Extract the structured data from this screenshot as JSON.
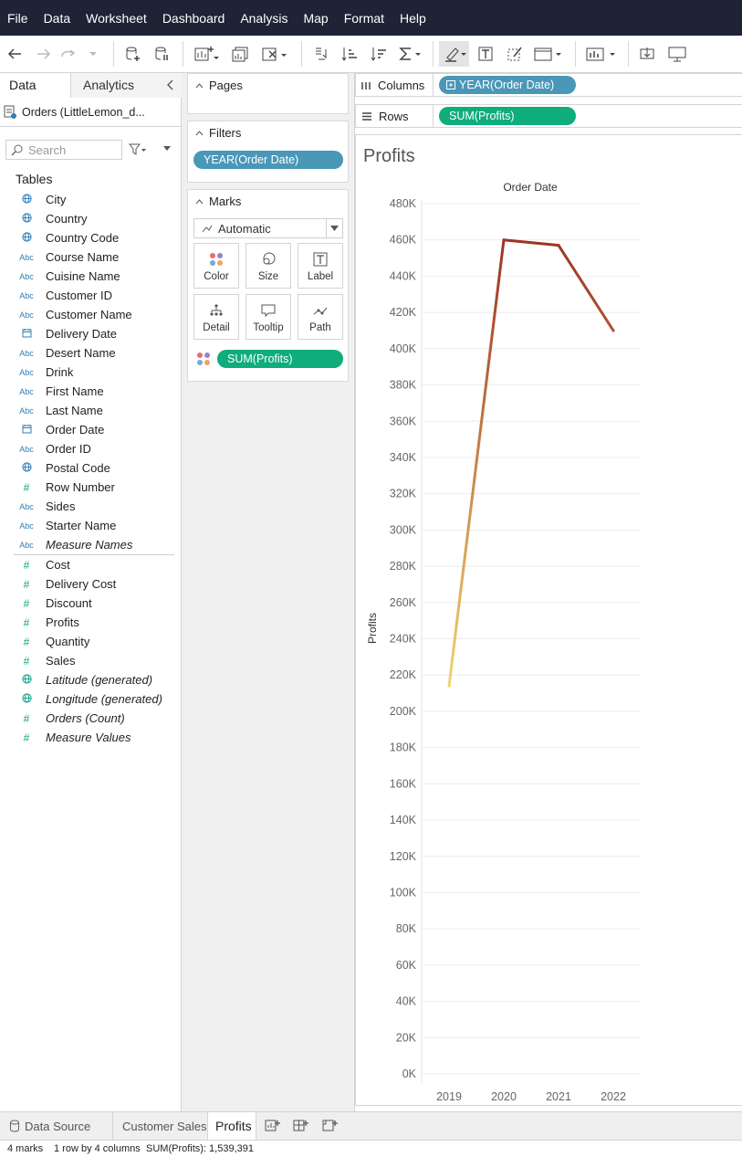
{
  "menu": [
    "File",
    "Data",
    "Worksheet",
    "Dashboard",
    "Analysis",
    "Map",
    "Format",
    "Help"
  ],
  "data_pane": {
    "tab_data": "Data",
    "tab_analytics": "Analytics",
    "datasource": "Orders (LittleLemon_d...",
    "search_placeholder": "Search",
    "tables_heading": "Tables",
    "dimensions": [
      {
        "label": "City",
        "icon": "globe-icon"
      },
      {
        "label": "Country",
        "icon": "globe-icon"
      },
      {
        "label": "Country Code",
        "icon": "globe-icon"
      },
      {
        "label": "Course Name",
        "icon": "abc-icon"
      },
      {
        "label": "Cuisine Name",
        "icon": "abc-icon"
      },
      {
        "label": "Customer ID",
        "icon": "abc-icon"
      },
      {
        "label": "Customer Name",
        "icon": "abc-icon"
      },
      {
        "label": "Delivery Date",
        "icon": "calendar-icon"
      },
      {
        "label": "Desert Name",
        "icon": "abc-icon"
      },
      {
        "label": "Drink",
        "icon": "abc-icon"
      },
      {
        "label": "First Name",
        "icon": "abc-icon"
      },
      {
        "label": "Last Name",
        "icon": "abc-icon"
      },
      {
        "label": "Order Date",
        "icon": "calendar-icon"
      },
      {
        "label": "Order ID",
        "icon": "abc-icon"
      },
      {
        "label": "Postal Code",
        "icon": "globe-icon"
      },
      {
        "label": "Row Number",
        "icon": "hash-icon"
      },
      {
        "label": "Sides",
        "icon": "abc-icon"
      },
      {
        "label": "Starter Name",
        "icon": "abc-icon"
      },
      {
        "label": "Measure Names",
        "icon": "abc-icon",
        "italic": true
      }
    ],
    "measures": [
      {
        "label": "Cost",
        "icon": "hash-icon"
      },
      {
        "label": "Delivery Cost",
        "icon": "hash-icon"
      },
      {
        "label": "Discount",
        "icon": "hash-icon"
      },
      {
        "label": "Profits",
        "icon": "hash-icon"
      },
      {
        "label": "Quantity",
        "icon": "hash-icon"
      },
      {
        "label": "Sales",
        "icon": "hash-icon"
      },
      {
        "label": "Latitude (generated)",
        "icon": "globe-icon",
        "italic": true
      },
      {
        "label": "Longitude (generated)",
        "icon": "globe-icon",
        "italic": true
      },
      {
        "label": "Orders (Count)",
        "icon": "hash-icon",
        "italic": true
      },
      {
        "label": "Measure Values",
        "icon": "hash-icon",
        "italic": true
      }
    ]
  },
  "cards": {
    "pages_title": "Pages",
    "filters_title": "Filters",
    "filter_pill": "YEAR(Order Date)",
    "marks_title": "Marks",
    "mark_type": "Automatic",
    "mark_buttons": [
      "Color",
      "Size",
      "Label",
      "Detail",
      "Tooltip",
      "Path"
    ],
    "marks_pill": "SUM(Profits)"
  },
  "shelves": {
    "columns_label": "Columns",
    "columns_pill": "YEAR(Order Date)",
    "rows_label": "Rows",
    "rows_pill": "SUM(Profits)"
  },
  "view": {
    "sheet_title": "Profits"
  },
  "chart_data": {
    "type": "line",
    "title": "",
    "xlabel": "Order Date",
    "ylabel": "Profits",
    "categories": [
      "2019",
      "2020",
      "2021",
      "2022"
    ],
    "series": [
      {
        "values": [
          214000,
          460000,
          457000,
          410000
        ]
      }
    ],
    "ylim": [
      0,
      480000
    ],
    "yticks": [
      "0K",
      "20K",
      "40K",
      "60K",
      "80K",
      "100K",
      "120K",
      "140K",
      "160K",
      "180K",
      "200K",
      "220K",
      "240K",
      "260K",
      "280K",
      "300K",
      "320K",
      "340K",
      "360K",
      "380K",
      "400K",
      "420K",
      "440K",
      "460K",
      "480K"
    ],
    "color_gradient": [
      "#f1d36e",
      "#9e3324"
    ],
    "grid": true
  },
  "sheet_tabs": {
    "data_source": "Data Source",
    "tabs": [
      "Customer Sales",
      "Profits"
    ],
    "active": "Profits"
  },
  "status": {
    "marks": "4 marks",
    "dims": "1 row by 4 columns",
    "sum": "SUM(Profits): 1,539,391"
  }
}
